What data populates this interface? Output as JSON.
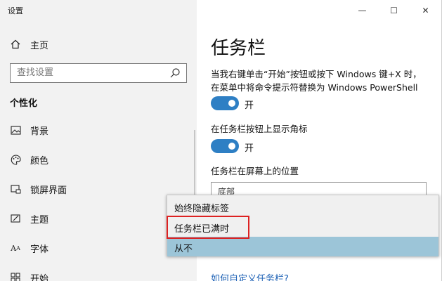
{
  "window": {
    "title": "设置"
  },
  "titlebar": {
    "minimize": "—",
    "maximize": "☐",
    "close": "✕"
  },
  "sidebar": {
    "home_label": "主页",
    "search_placeholder": "查找设置",
    "section_title": "个性化",
    "items": [
      {
        "label": "背景",
        "icon": "image-icon"
      },
      {
        "label": "颜色",
        "icon": "palette-icon"
      },
      {
        "label": "锁屏界面",
        "icon": "lock-screen-icon"
      },
      {
        "label": "主题",
        "icon": "theme-icon"
      },
      {
        "label": "字体",
        "icon": "font-icon"
      },
      {
        "label": "开始",
        "icon": "start-icon"
      }
    ]
  },
  "main": {
    "title": "任务栏",
    "setting1": {
      "line1": "当我右键单击“开始”按钮或按下 Windows 键+X 时，",
      "line2": "在菜单中将命令提示符替换为 Windows PowerShell",
      "state": "开"
    },
    "setting2": {
      "label": "在任务栏按钮上显示角标",
      "state": "开"
    },
    "setting3": {
      "label": "任务栏在屏幕上的位置",
      "value": "底部"
    },
    "link": "如何自定义任务栏?"
  },
  "dropdown": {
    "options": [
      "始终隐藏标签",
      "任务栏已满时",
      "从不"
    ],
    "selected": "从不"
  },
  "colors": {
    "accent": "#2e7fc4",
    "selected": "#9cc5d8",
    "highlight": "#dd2222"
  }
}
